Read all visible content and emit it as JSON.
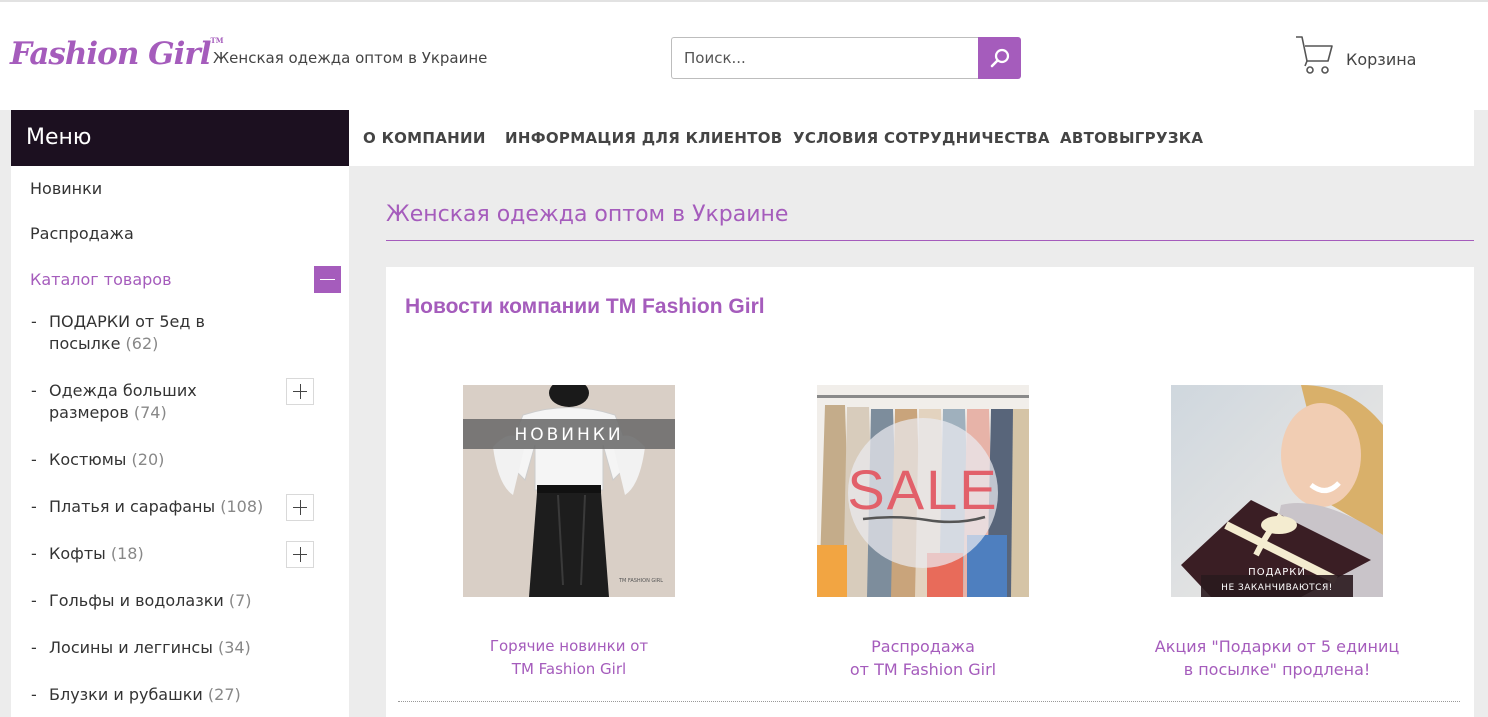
{
  "header": {
    "logo_text": "Fashion Girl",
    "logo_tm": "TM",
    "tagline": "Женская одежда оптом в Украине",
    "search_placeholder": "Поиск...",
    "cart_label": "Корзина"
  },
  "sidebar": {
    "menu_title": "Меню",
    "items": [
      {
        "label": "Новинки"
      },
      {
        "label": "Распродажа"
      },
      {
        "label": "Каталог товаров"
      }
    ],
    "categories": [
      {
        "label": "ПОДАРКИ от 5ед в посылке",
        "count": "(62)",
        "expandable": false
      },
      {
        "label": "Одежда больших размеров",
        "count": "(74)",
        "expandable": true
      },
      {
        "label": "Костюмы",
        "count": "(20)",
        "expandable": false
      },
      {
        "label": "Платья и сарафаны",
        "count": "(108)",
        "expandable": true
      },
      {
        "label": "Кофты",
        "count": "(18)",
        "expandable": true
      },
      {
        "label": "Гольфы и водолазки",
        "count": "(7)",
        "expandable": false
      },
      {
        "label": "Лосины и леггинсы",
        "count": "(34)",
        "expandable": false
      },
      {
        "label": "Блузки и рубашки",
        "count": "(27)",
        "expandable": false
      }
    ]
  },
  "topnav": [
    "О КОМПАНИИ",
    "ИНФОРМАЦИЯ ДЛЯ КЛИЕНТОВ",
    "УСЛОВИЯ СОТРУДНИЧЕСТВА",
    "АВТОВЫГРУЗКА"
  ],
  "main": {
    "page_title": "Женская одежда оптом в Украине",
    "news_title": "Новости компании ТМ Fashion Girl",
    "news": [
      {
        "line1": "Горячие новинки от",
        "line2": "TM Fashion Girl",
        "image_text": "НОВИНКИ",
        "image_small": "TM FASHION GIRL"
      },
      {
        "line1": "Распродажа",
        "line2": "от TM Fashion Girl",
        "image_text": "SALE"
      },
      {
        "line1": "Акция \"Подарки от 5 единиц",
        "line2": "в посылке\" продлена!",
        "image_text1": "ПОДАРКИ",
        "image_text2": "НЕ ЗАКАНЧИВАЮТСЯ!"
      }
    ]
  },
  "colors": {
    "accent": "#a55cbc",
    "menu_bg": "#1c1020"
  }
}
